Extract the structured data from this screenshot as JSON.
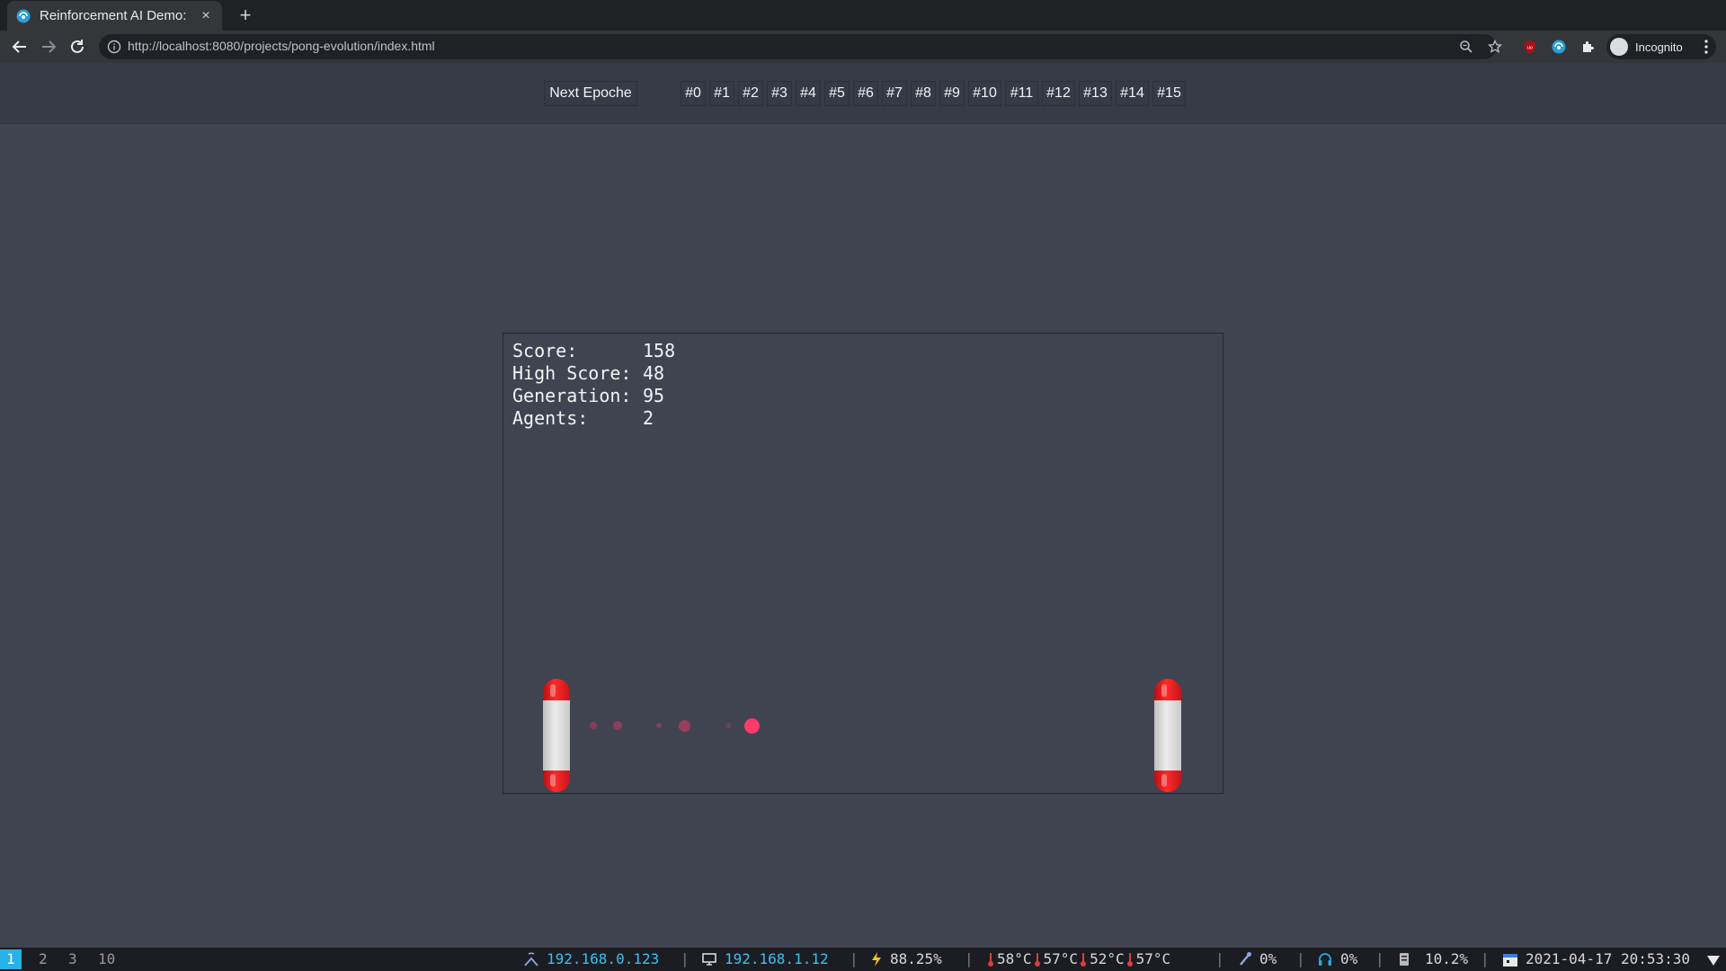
{
  "browser": {
    "tab_title": "Reinforcement AI Demo:",
    "tab_close": "×",
    "new_tab": "+",
    "url": "http://localhost:8080/projects/pong-evolution/index.html",
    "profile_label": "Incognito",
    "theme": "dark"
  },
  "nav": {
    "next_epoche_label": "Next Epoche",
    "epochs": [
      "#0",
      "#1",
      "#2",
      "#3",
      "#4",
      "#5",
      "#6",
      "#7",
      "#8",
      "#9",
      "#10",
      "#11",
      "#12",
      "#13",
      "#14",
      "#15"
    ]
  },
  "game": {
    "score_label": "Score:",
    "score_value": "158",
    "high_score_label": "High Score:",
    "high_score_value": "48",
    "generation_label": "Generation:",
    "generation_value": "95",
    "agents_label": "Agents:",
    "agents_value": "2",
    "paddle_color": "#ff2a2a",
    "ball_color": "#ff3b6c"
  },
  "statusbar": {
    "workspaces": [
      "1",
      "2",
      "3",
      "10"
    ],
    "active_workspace": "1",
    "wifi_ip": "192.168.0.123",
    "lan_ip": "192.168.1.12",
    "battery": "88.25%",
    "temps": [
      "58°C",
      "57°C",
      "52°C",
      "57°C"
    ],
    "mic": "0%",
    "volume": "0%",
    "disk": "10.2%",
    "datetime": "2021-04-17 20:53:30",
    "separator": "|"
  }
}
